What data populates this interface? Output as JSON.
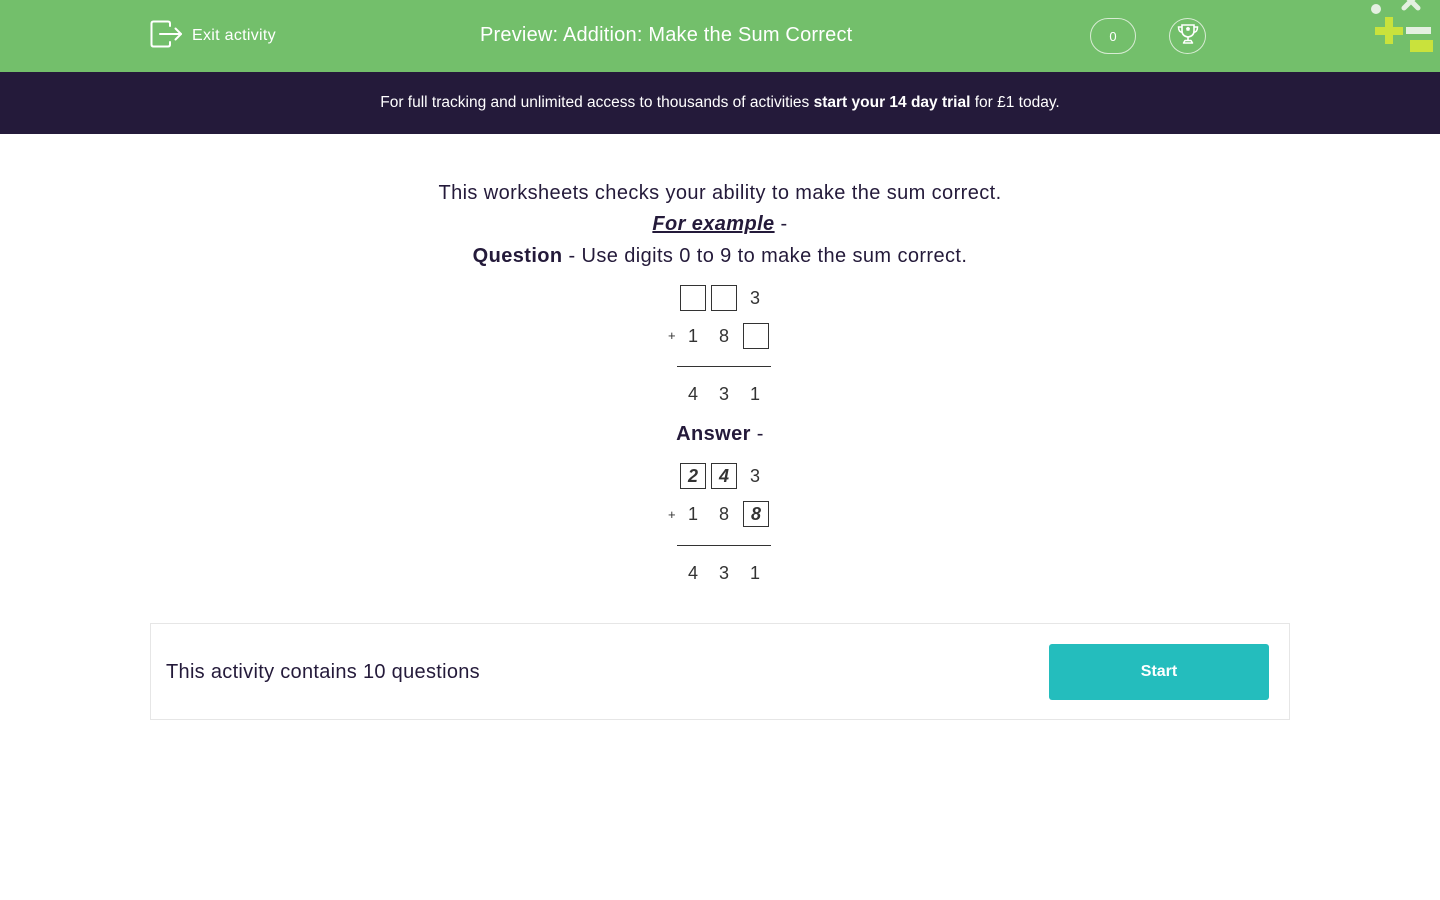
{
  "header": {
    "exit_label": "Exit activity",
    "title": "Preview: Addition: Make the Sum Correct",
    "score": "0",
    "colors": {
      "header_bg": "#73bf6b",
      "banner_bg": "#241a3a",
      "accent": "#24bdbd"
    }
  },
  "banner": {
    "text_before": "For full tracking and unlimited access to thousands of activities ",
    "text_bold": "start your 14 day trial",
    "text_after": " for £1 today."
  },
  "intro": {
    "line1": "This worksheets checks your ability to make the sum correct.",
    "example_label": "For example",
    "example_suffix": " -",
    "question_label": "Question",
    "question_text": " - Use digits 0 to 9 to make the sum correct.",
    "answer_label": "Answer",
    "answer_suffix": " -"
  },
  "question_sum": {
    "row1": [
      "",
      "",
      "3"
    ],
    "row2": [
      "1",
      "8",
      ""
    ],
    "operator": "+",
    "result": [
      "4",
      "3",
      "1"
    ]
  },
  "answer_sum": {
    "row1": [
      "2",
      "4",
      "3"
    ],
    "row2": [
      "1",
      "8",
      "8"
    ],
    "operator": "+",
    "result": [
      "4",
      "3",
      "1"
    ]
  },
  "footer": {
    "info": "This activity contains 10 questions",
    "start_label": "Start"
  }
}
